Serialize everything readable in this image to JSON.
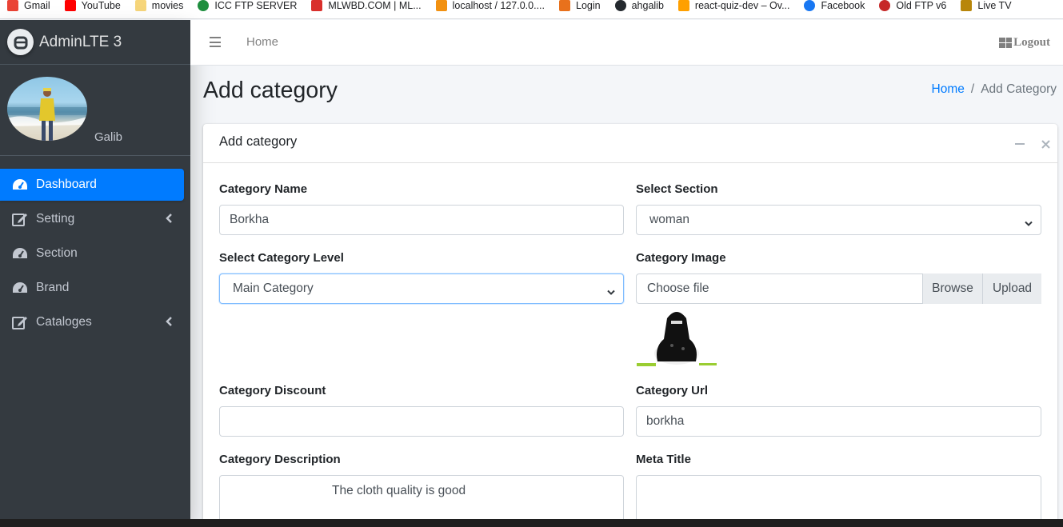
{
  "bookmarks": [
    {
      "label": "Gmail",
      "color": "#ea4335"
    },
    {
      "label": "YouTube",
      "color": "#ff0000"
    },
    {
      "label": "movies",
      "color": "#f6d57a"
    },
    {
      "label": "ICC FTP SERVER",
      "color": "#1e8e3e"
    },
    {
      "label": "MLWBD.COM | ML...",
      "color": "#d9302c"
    },
    {
      "label": "localhost / 127.0.0....",
      "color": "#f29111"
    },
    {
      "label": "Login",
      "color": "#e8711c"
    },
    {
      "label": "ahgalib",
      "color": "#24292e"
    },
    {
      "label": "react-quiz-dev – Ov...",
      "color": "#ffa000"
    },
    {
      "label": "Facebook",
      "color": "#1877f2"
    },
    {
      "label": "Old FTP v6",
      "color": "#c62828"
    },
    {
      "label": "Live TV",
      "color": "#b8860b"
    }
  ],
  "brand": {
    "name": "AdminLTE 3"
  },
  "user": {
    "name": "Galib"
  },
  "sidebar": {
    "items": [
      {
        "label": "Dashboard",
        "icon": "tachometer-icon",
        "active": true,
        "has_arrow": false
      },
      {
        "label": "Setting",
        "icon": "edit-icon",
        "active": false,
        "has_arrow": true
      },
      {
        "label": "Section",
        "icon": "tachometer-icon",
        "active": false,
        "has_arrow": false
      },
      {
        "label": "Brand",
        "icon": "tachometer-icon",
        "active": false,
        "has_arrow": false
      },
      {
        "label": "Cataloges",
        "icon": "edit-icon",
        "active": false,
        "has_arrow": true
      }
    ]
  },
  "topbar": {
    "home": "Home",
    "logout": "Logout"
  },
  "page": {
    "title": "Add category"
  },
  "breadcrumb": {
    "home": "Home",
    "separator": "/",
    "current": "Add Category"
  },
  "card": {
    "title": "Add category"
  },
  "form": {
    "category_name": {
      "label": "Category Name",
      "value": "Borkha"
    },
    "section": {
      "label": "Select Section",
      "value": "woman"
    },
    "level": {
      "label": "Select Category Level",
      "value": "Main Category"
    },
    "image": {
      "label": "Category Image",
      "placeholder": "Choose file",
      "browse": "Browse",
      "upload": "Upload"
    },
    "discount": {
      "label": "Category Discount",
      "value": ""
    },
    "url": {
      "label": "Category Url",
      "value": "borkha"
    },
    "description": {
      "label": "Category Description",
      "value": "The cloth quality is good"
    },
    "meta_title": {
      "label": "Meta Title",
      "value": ""
    }
  },
  "colors": {
    "sidebar": "#343a40",
    "active": "#007bff",
    "link": "#007bff",
    "content_bg": "#f4f6f9"
  }
}
